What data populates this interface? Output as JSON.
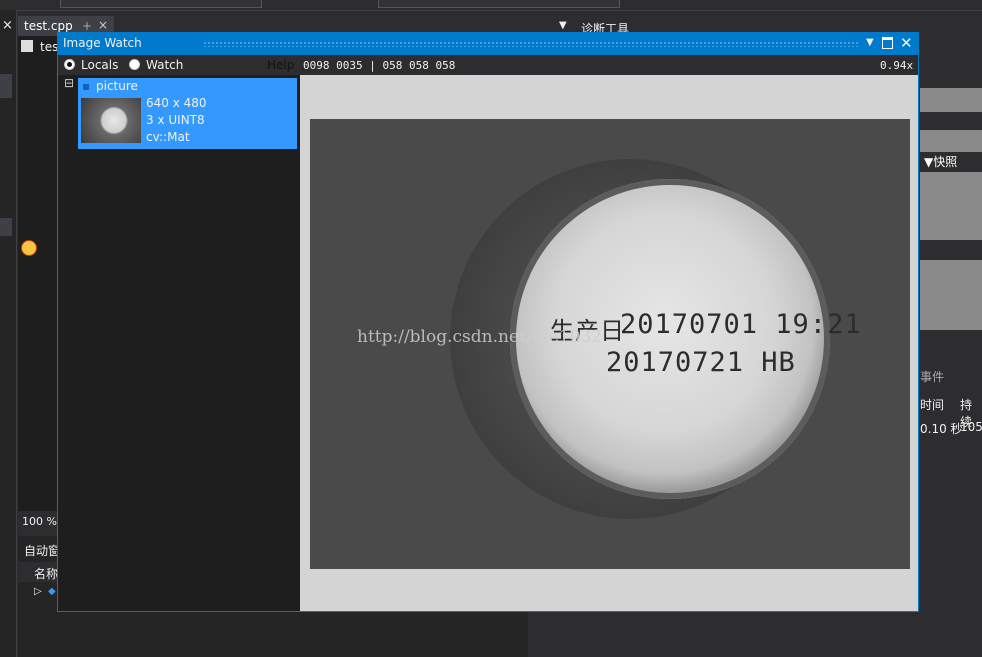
{
  "ide": {
    "doc_tab_label": "test.cpp",
    "doc_tab_pin": "+",
    "doc_tab_close": "×",
    "sub_tab_label": "tes",
    "left_close": "×",
    "zoom_level": "100 %",
    "auto_panel_title": "自动窗",
    "auto_panel_col_name": "名称",
    "diag_tools_title": "诊断工具",
    "snapshot_label": "▼快照",
    "events_label": "事件",
    "col_time": "时间",
    "col_duration": "持续",
    "row_time": "0.10 秒",
    "row_duration": "105"
  },
  "image_watch": {
    "title": "Image Watch",
    "radio_locals": "Locals",
    "radio_watch": "Watch",
    "help_label": "Help",
    "pixel_info": "0098 0035 | 058 058 058",
    "zoom": "0.94x",
    "expand_glyph": "⊟",
    "item": {
      "name": "picture",
      "size": "640 x 480",
      "channels": "3 x UINT8",
      "type": "cv::Mat"
    },
    "image_text_line1_prefix": "生产日",
    "image_text_line1": "20170701 19:21",
    "image_text_line2": "20170721 HB",
    "watermark": "http://blog.csdn.net/life1032"
  },
  "colors": {
    "accent": "#007acc",
    "selection": "#3399ff",
    "ide_bg": "#2d2d30"
  }
}
